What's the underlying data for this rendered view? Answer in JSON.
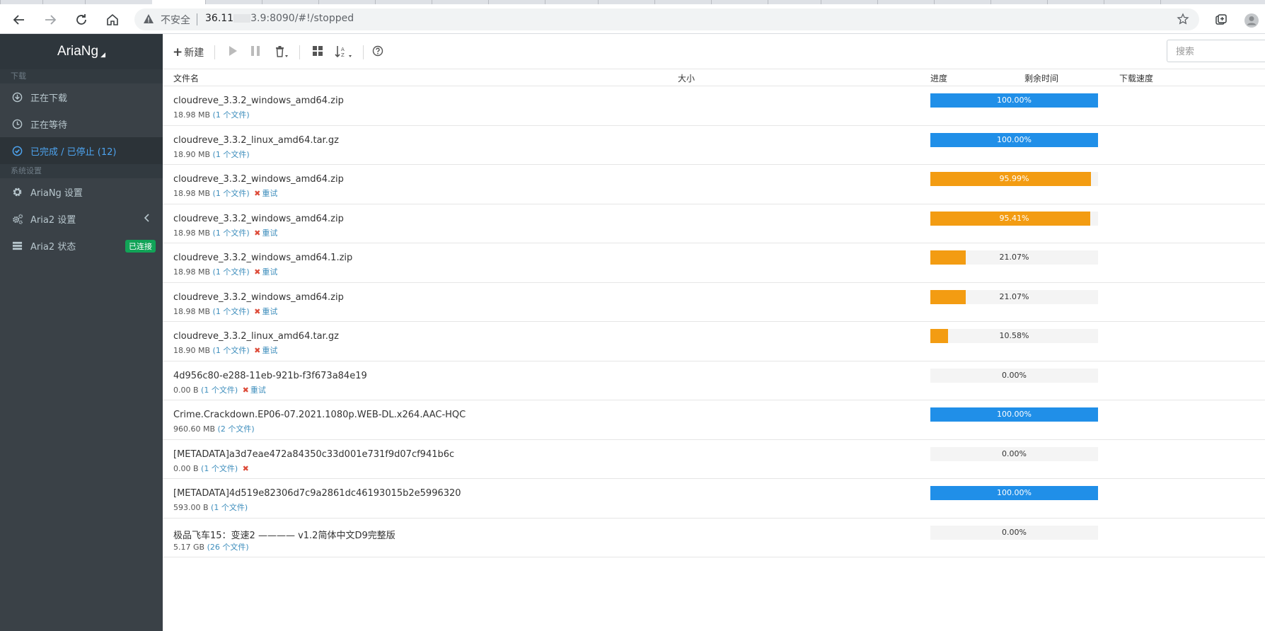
{
  "browser": {
    "insecure_label": "不安全",
    "url_prefix": "36.11",
    "url_suffix": "3.9:8090/#!/stopped"
  },
  "sidebar": {
    "brand": "AriaNg",
    "sections": {
      "download": "下载",
      "settings": "系统设置"
    },
    "items": [
      {
        "label": "正在下载",
        "icon": "download-icon"
      },
      {
        "label": "正在等待",
        "icon": "clock-icon"
      },
      {
        "label": "已完成 / 已停止 (12)",
        "icon": "check-circle-icon"
      },
      {
        "label": "AriaNg 设置",
        "icon": "gear-icon"
      },
      {
        "label": "Aria2 设置",
        "icon": "gears-icon"
      },
      {
        "label": "Aria2 状态",
        "icon": "server-icon",
        "badge": "已连接"
      }
    ]
  },
  "toolbar": {
    "new_label": "新建",
    "search_placeholder": "搜索"
  },
  "table": {
    "headers": {
      "name": "文件名",
      "size": "大小",
      "progress": "进度",
      "remaining": "剩余时间",
      "speed": "下载速度"
    },
    "rows": [
      {
        "name": "cloudreve_3.3.2_windows_amd64.zip",
        "size": "18.98 MB",
        "files": "(1 个文件)",
        "retry": "",
        "progress": 100.0,
        "progress_text": "100.00%",
        "color": "blue"
      },
      {
        "name": "cloudreve_3.3.2_linux_amd64.tar.gz",
        "size": "18.90 MB",
        "files": "(1 个文件)",
        "retry": "",
        "progress": 100.0,
        "progress_text": "100.00%",
        "color": "blue"
      },
      {
        "name": "cloudreve_3.3.2_windows_amd64.zip",
        "size": "18.98 MB",
        "files": "(1 个文件)",
        "retry": "重试",
        "progress": 95.99,
        "progress_text": "95.99%",
        "color": "orange"
      },
      {
        "name": "cloudreve_3.3.2_windows_amd64.zip",
        "size": "18.98 MB",
        "files": "(1 个文件)",
        "retry": "重试",
        "progress": 95.41,
        "progress_text": "95.41%",
        "color": "orange"
      },
      {
        "name": "cloudreve_3.3.2_windows_amd64.1.zip",
        "size": "18.98 MB",
        "files": "(1 个文件)",
        "retry": "重试",
        "progress": 21.07,
        "progress_text": "21.07%",
        "color": "orange"
      },
      {
        "name": "cloudreve_3.3.2_windows_amd64.zip",
        "size": "18.98 MB",
        "files": "(1 个文件)",
        "retry": "重试",
        "progress": 21.07,
        "progress_text": "21.07%",
        "color": "orange"
      },
      {
        "name": "cloudreve_3.3.2_linux_amd64.tar.gz",
        "size": "18.90 MB",
        "files": "(1 个文件)",
        "retry": "重试",
        "progress": 10.58,
        "progress_text": "10.58%",
        "color": "orange"
      },
      {
        "name": "4d956c80-e288-11eb-921b-f3f673a84e19",
        "size": "0.00 B",
        "files": "(1 个文件)",
        "retry": "重试",
        "progress": 0,
        "progress_text": "0.00%",
        "color": "orange"
      },
      {
        "name": "Crime.Crackdown.EP06-07.2021.1080p.WEB-DL.x264.AAC-HQC",
        "size": "960.60 MB",
        "files": "(2 个文件)",
        "retry": "",
        "progress": 100.0,
        "progress_text": "100.00%",
        "color": "blue"
      },
      {
        "name": "[METADATA]a3d7eae472a84350c33d001e731f9d07cf941b6c",
        "size": "0.00 B",
        "files": "(1 个文件)",
        "retry": "",
        "remove_only": true,
        "progress": 0,
        "progress_text": "0.00%",
        "color": "orange"
      },
      {
        "name": "[METADATA]4d519e82306d7c9a2861dc46193015b2e5996320",
        "size": "593.00 B",
        "files": "(1 个文件)",
        "retry": "",
        "progress": 100.0,
        "progress_text": "100.00%",
        "color": "blue"
      },
      {
        "name": "极品飞车15：变速2 ———— v1.2简体中文D9完整版",
        "size": "5.17 GB",
        "files": "(26 个文件)",
        "retry": "",
        "progress": 0,
        "progress_text": "0.00%",
        "color": "orange"
      }
    ]
  },
  "colors": {
    "blue": "#208fe8",
    "orange": "#f39c12",
    "sidebar": "#3a4147",
    "badge": "#11a357"
  }
}
